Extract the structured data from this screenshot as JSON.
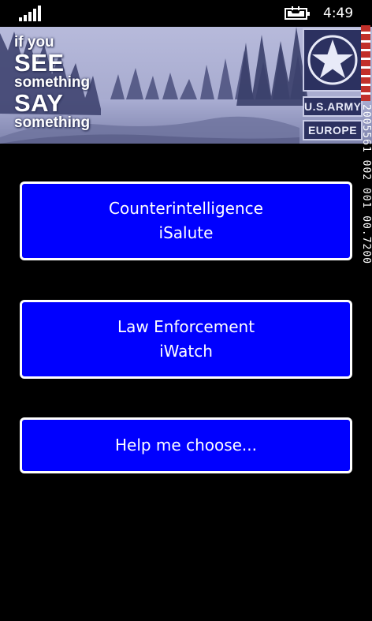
{
  "status_bar": {
    "time": "4:49",
    "signal_icon": "signal-bars-icon",
    "battery_icon": "battery-charging-icon"
  },
  "banner": {
    "slogan": {
      "line1": "if you",
      "line2": "SEE",
      "line3": "something",
      "line4": "SAY",
      "line5": "something"
    },
    "logo": {
      "icon": "army-star-icon",
      "line1": "U.S.ARMY",
      "line2": "EUROPE"
    },
    "side_text": "2005561 002 001 00.7200"
  },
  "buttons": [
    {
      "line1": "Counterintelligence",
      "line2": "iSalute"
    },
    {
      "line1": "Law Enforcement",
      "line2": "iWatch"
    },
    {
      "line1": "Help me choose..."
    }
  ],
  "colors": {
    "background": "#000000",
    "button_fill": "#0000ff",
    "button_border": "#ffffff",
    "banner_tint": "#8f93b8",
    "logo_navy": "#2c3160",
    "ribbon_red": "#c2302a"
  }
}
